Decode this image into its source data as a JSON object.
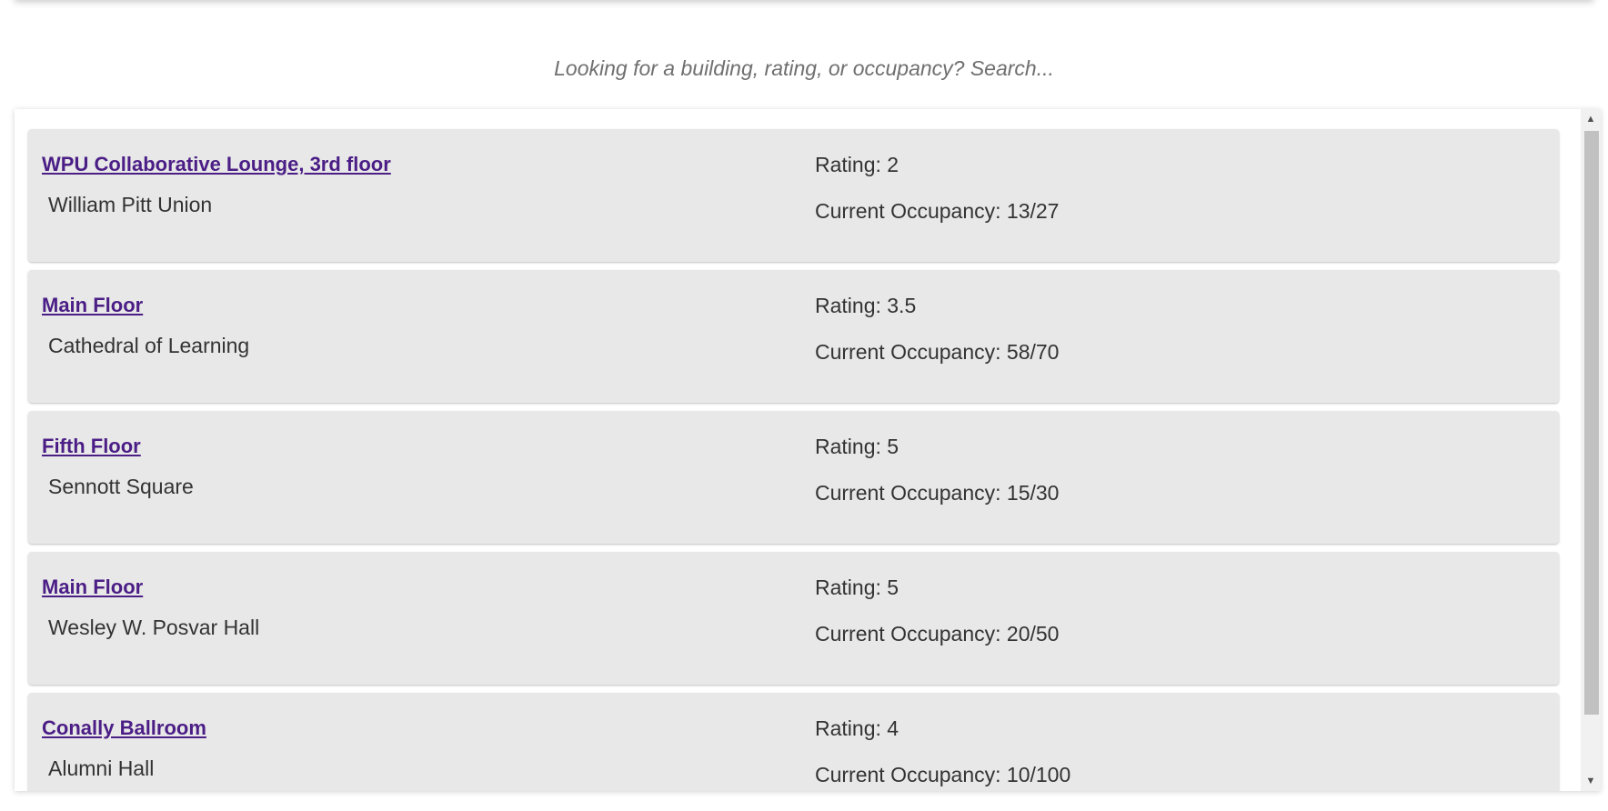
{
  "search": {
    "placeholder": "Looking for a building, rating, or occupancy? Search..."
  },
  "spots": [
    {
      "name": "WPU Collaborative Lounge, 3rd floor",
      "building": "William Pitt Union",
      "rating": "Rating: 2",
      "occupancy": "Current Occupancy: 13/27"
    },
    {
      "name": "Main Floor",
      "building": "Cathedral of Learning",
      "rating": "Rating: 3.5",
      "occupancy": "Current Occupancy: 58/70"
    },
    {
      "name": "Fifth Floor",
      "building": "Sennott Square",
      "rating": "Rating: 5",
      "occupancy": "Current Occupancy: 15/30"
    },
    {
      "name": "Main Floor",
      "building": "Wesley W. Posvar Hall",
      "rating": "Rating: 5",
      "occupancy": "Current Occupancy: 20/50"
    },
    {
      "name": "Conally Ballroom",
      "building": "Alumni Hall",
      "rating": "Rating: 4",
      "occupancy": "Current Occupancy: 10/100"
    }
  ],
  "icons": {
    "scroll_up": "triangle-up-icon",
    "scroll_down": "triangle-down-icon"
  },
  "colors": {
    "link": "#4b1e86",
    "card_background": "#e8e8e8",
    "text": "#333333",
    "placeholder": "#6f6f6f"
  }
}
